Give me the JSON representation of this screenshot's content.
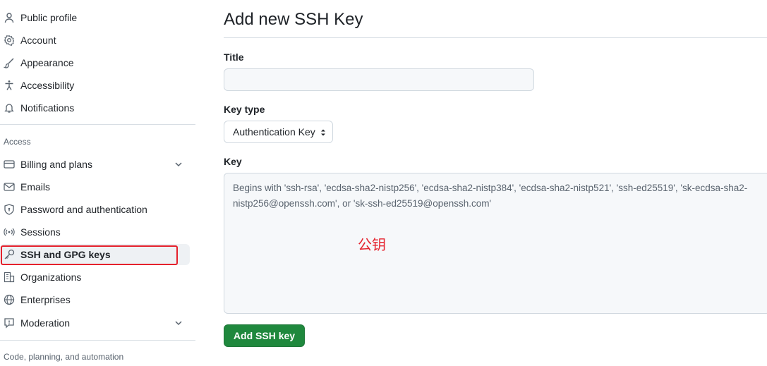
{
  "sidebar": {
    "items_top": [
      {
        "label": "Public profile",
        "icon": "person-icon"
      },
      {
        "label": "Account",
        "icon": "gear-icon"
      },
      {
        "label": "Appearance",
        "icon": "paintbrush-icon"
      },
      {
        "label": "Accessibility",
        "icon": "accessibility-icon"
      },
      {
        "label": "Notifications",
        "icon": "bell-icon"
      }
    ],
    "access_heading": "Access",
    "items_access": [
      {
        "label": "Billing and plans",
        "icon": "credit-card-icon",
        "expandable": true
      },
      {
        "label": "Emails",
        "icon": "mail-icon"
      },
      {
        "label": "Password and authentication",
        "icon": "shield-lock-icon"
      },
      {
        "label": "Sessions",
        "icon": "broadcast-icon"
      },
      {
        "label": "SSH and GPG keys",
        "icon": "key-icon",
        "selected": true
      },
      {
        "label": "Organizations",
        "icon": "organization-icon"
      },
      {
        "label": "Enterprises",
        "icon": "globe-icon"
      },
      {
        "label": "Moderation",
        "icon": "report-icon",
        "expandable": true
      }
    ],
    "code_heading": "Code, planning, and automation"
  },
  "main": {
    "title": "Add new SSH Key",
    "title_field": {
      "label": "Title",
      "value": "",
      "placeholder": ""
    },
    "key_type_field": {
      "label": "Key type",
      "selected": "Authentication Key"
    },
    "key_field": {
      "label": "Key",
      "placeholder": "Begins with 'ssh-rsa', 'ecdsa-sha2-nistp256', 'ecdsa-sha2-nistp384', 'ecdsa-sha2-nistp521', 'ssh-ed25519', 'sk-ecdsa-sha2-nistp256@openssh.com', or 'sk-ssh-ed25519@openssh.com'"
    },
    "annotation": "公钥",
    "submit_label": "Add SSH key"
  },
  "colors": {
    "accent_green": "#1f883d",
    "annotation_red": "#e5212c",
    "selected_bg": "#eef1f4"
  }
}
